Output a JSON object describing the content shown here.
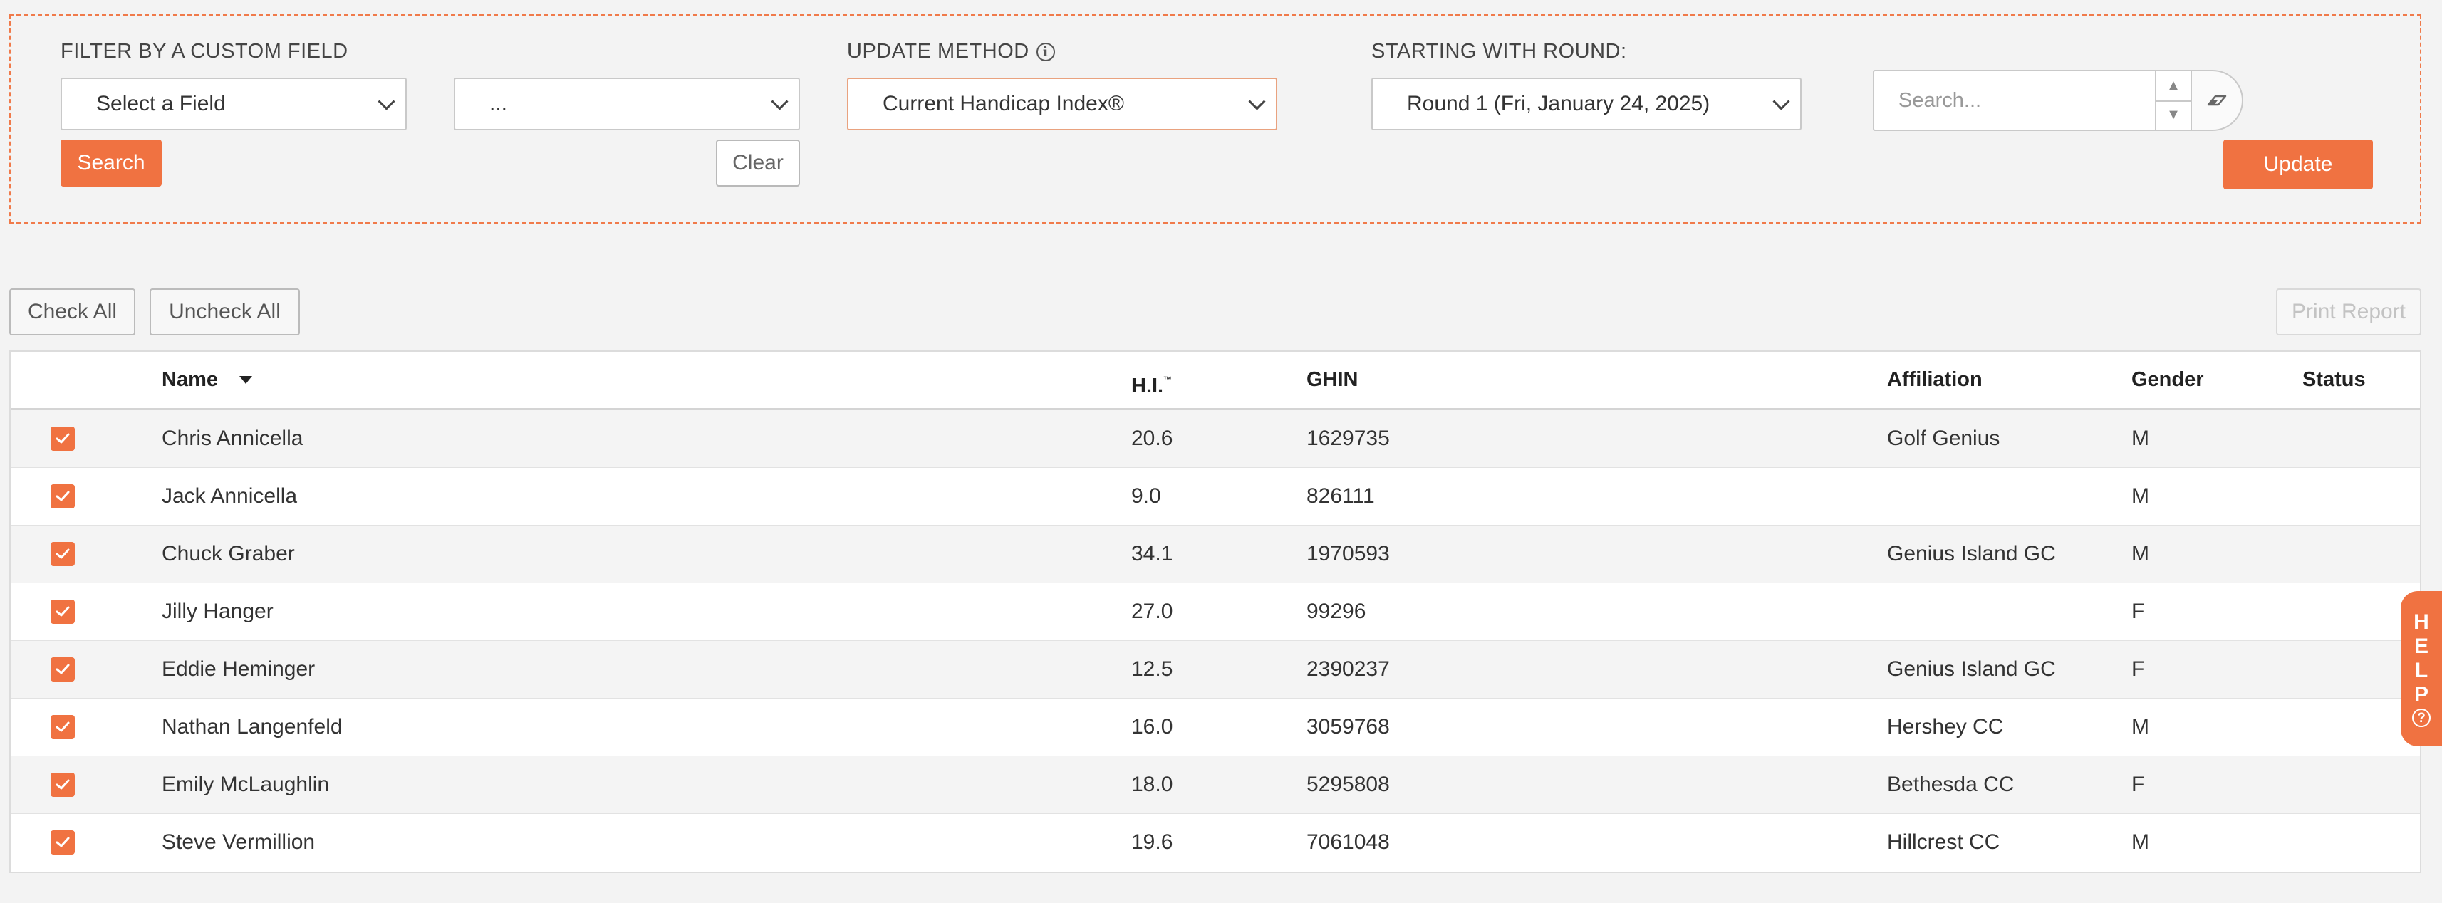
{
  "filter": {
    "custom_field_label": "FILTER BY A CUSTOM FIELD",
    "field_select_value": "Select a Field",
    "value_select_value": "...",
    "search_label": "Search",
    "clear_label": "Clear",
    "update_method_label": "UPDATE METHOD",
    "update_method_value": "Current Handicap Index®",
    "round_label": "STARTING WITH ROUND:",
    "round_value": "Round 1 (Fri, January 24, 2025)",
    "search_placeholder": "Search...",
    "update_label": "Update"
  },
  "toolbar": {
    "check_all_label": "Check All",
    "uncheck_all_label": "Uncheck All",
    "print_report_label": "Print Report"
  },
  "table": {
    "headers": {
      "name": "Name",
      "hi": "H.I.",
      "hi_mark": "™",
      "ghin": "GHIN",
      "affiliation": "Affiliation",
      "gender": "Gender",
      "status": "Status"
    },
    "rows": [
      {
        "name": "Chris Annicella",
        "hi": "20.6",
        "ghin": "1629735",
        "affiliation": "Golf Genius",
        "gender": "M",
        "status": ""
      },
      {
        "name": "Jack Annicella",
        "hi": "9.0",
        "ghin": "826111",
        "affiliation": "",
        "gender": "M",
        "status": ""
      },
      {
        "name": "Chuck Graber",
        "hi": "34.1",
        "ghin": "1970593",
        "affiliation": "Genius Island GC",
        "gender": "M",
        "status": ""
      },
      {
        "name": "Jilly Hanger",
        "hi": "27.0",
        "ghin": "99296",
        "affiliation": "",
        "gender": "F",
        "status": ""
      },
      {
        "name": "Eddie Heminger",
        "hi": "12.5",
        "ghin": "2390237",
        "affiliation": "Genius Island GC",
        "gender": "F",
        "status": ""
      },
      {
        "name": "Nathan Langenfeld",
        "hi": "16.0",
        "ghin": "3059768",
        "affiliation": "Hershey CC",
        "gender": "M",
        "status": ""
      },
      {
        "name": "Emily McLaughlin",
        "hi": "18.0",
        "ghin": "5295808",
        "affiliation": "Bethesda CC",
        "gender": "F",
        "status": ""
      },
      {
        "name": "Steve Vermillion",
        "hi": "19.6",
        "ghin": "7061048",
        "affiliation": "Hillcrest CC",
        "gender": "M",
        "status": ""
      }
    ]
  },
  "help": {
    "letters": [
      "H",
      "E",
      "L",
      "P"
    ],
    "icon": "?"
  },
  "colors": {
    "accent": "#f07241",
    "dashed_border": "#f07a4a",
    "background": "#f3f3f3"
  },
  "icons": {
    "info": "info-icon",
    "eraser": "eraser-icon",
    "sort": "sort-desc-icon",
    "check": "check-icon",
    "chevron": "chevron-down-icon"
  }
}
